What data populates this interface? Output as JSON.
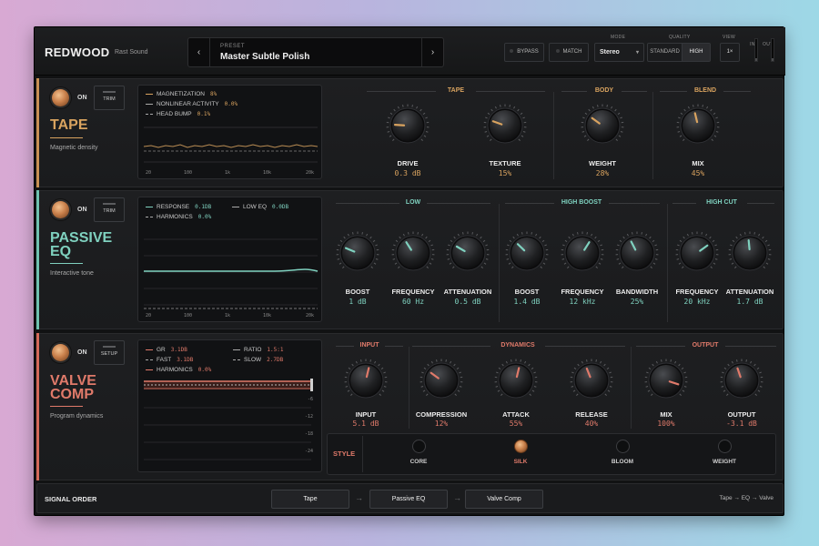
{
  "header": {
    "brand": "REDWOOD",
    "brand_sub": "Rast Sound",
    "preset_label": "PRESET",
    "preset_name": "Master Subtle Polish",
    "prev": "‹",
    "next": "›",
    "bypass": "BYPASS",
    "match": "MATCH",
    "mode_label": "MODE",
    "mode_value": "Stereo",
    "quality_label": "QUALITY",
    "quality_options": [
      "STANDARD",
      "HIGH"
    ],
    "quality_selected": "HIGH",
    "view_label": "VIEW",
    "view_value": "1×",
    "in_label": "IN",
    "out_label": "OUT"
  },
  "tape": {
    "on": "ON",
    "trim": "TRIM",
    "title": "TAPE",
    "subtitle": "Magnetic density",
    "accent": "#d9a35f",
    "legend": [
      {
        "label": "MAGNETIZATION",
        "value": "8%"
      },
      {
        "label": "NONLINEAR ACTIVITY",
        "value": "0.0%"
      },
      {
        "label": "HEAD BUMP",
        "value": "0.1%"
      }
    ],
    "freq_ticks": [
      "20",
      "100",
      "1k",
      "10k",
      "20k"
    ],
    "groups": [
      "TAPE",
      "BODY",
      "BLEND"
    ],
    "knobs": [
      {
        "label": "DRIVE",
        "value": "0.3 dB",
        "level": 0.18
      },
      {
        "label": "TEXTURE",
        "value": "15%",
        "level": 0.24
      },
      {
        "label": "WEIGHT",
        "value": "28%",
        "level": 0.3
      },
      {
        "label": "MIX",
        "value": "45%",
        "level": 0.45
      }
    ]
  },
  "eq": {
    "on": "ON",
    "trim": "TRIM",
    "title_line1": "PASSIVE",
    "title_line2": "EQ",
    "subtitle": "Interactive tone",
    "accent": "#7fd1bf",
    "legend": [
      {
        "label": "RESPONSE",
        "value": "0.1DB"
      },
      {
        "label": "LOW EQ",
        "value": "0.0DB"
      },
      {
        "label": "HARMONICS",
        "value": "0.0%"
      }
    ],
    "freq_ticks": [
      "20",
      "100",
      "1k",
      "10k",
      "20k"
    ],
    "groups": [
      "LOW",
      "HIGH BOOST",
      "HIGH CUT"
    ],
    "knobs": [
      {
        "label": "BOOST",
        "value": "1 dB",
        "level": 0.25
      },
      {
        "label": "FREQUENCY",
        "value": "60 Hz",
        "level": 0.38
      },
      {
        "label": "ATTENUATION",
        "value": "0.5 dB",
        "level": 0.28
      },
      {
        "label": "BOOST",
        "value": "1.4 dB",
        "level": 0.33
      },
      {
        "label": "FREQUENCY",
        "value": "12 kHz",
        "level": 0.62
      },
      {
        "label": "BANDWIDTH",
        "value": "25%",
        "level": 0.4
      },
      {
        "label": "FREQUENCY",
        "value": "20 kHz",
        "level": 0.7
      },
      {
        "label": "ATTENUATION",
        "value": "1.7 dB",
        "level": 0.48
      }
    ]
  },
  "comp": {
    "on": "ON",
    "setup": "SETUP",
    "title_line1": "VALVE",
    "title_line2": "COMP",
    "subtitle": "Program dynamics",
    "accent": "#e07a6a",
    "legend": [
      {
        "label": "GR",
        "value": "3.1DB"
      },
      {
        "label": "RATIO",
        "value": "1.5:1"
      },
      {
        "label": "FAST",
        "value": "3.1DB"
      },
      {
        "label": "SLOW",
        "value": "2.7DB"
      },
      {
        "label": "HARMONICS",
        "value": "0.0%"
      }
    ],
    "db_ticks": [
      "-6",
      "-12",
      "-18",
      "-24"
    ],
    "groups": [
      "INPUT",
      "DYNAMICS",
      "OUTPUT"
    ],
    "knobs": [
      {
        "label": "INPUT",
        "value": "5.1 dB",
        "level": 0.55
      },
      {
        "label": "COMPRESSION",
        "value": "12%",
        "level": 0.3
      },
      {
        "label": "ATTACK",
        "value": "55%",
        "level": 0.55
      },
      {
        "label": "RELEASE",
        "value": "40%",
        "level": 0.42
      },
      {
        "label": "MIX",
        "value": "100%",
        "level": 0.9
      },
      {
        "label": "OUTPUT",
        "value": "-3.1 dB",
        "level": 0.43
      }
    ],
    "style_label": "STYLE",
    "styles": [
      "CORE",
      "SILK",
      "BLOOM",
      "WEIGHT"
    ],
    "style_selected": "SILK"
  },
  "footer": {
    "label": "SIGNAL ORDER",
    "chain": [
      "Tape",
      "Passive EQ",
      "Valve Comp"
    ],
    "arrow": "→",
    "summary": "Tape → EQ → Valve"
  }
}
